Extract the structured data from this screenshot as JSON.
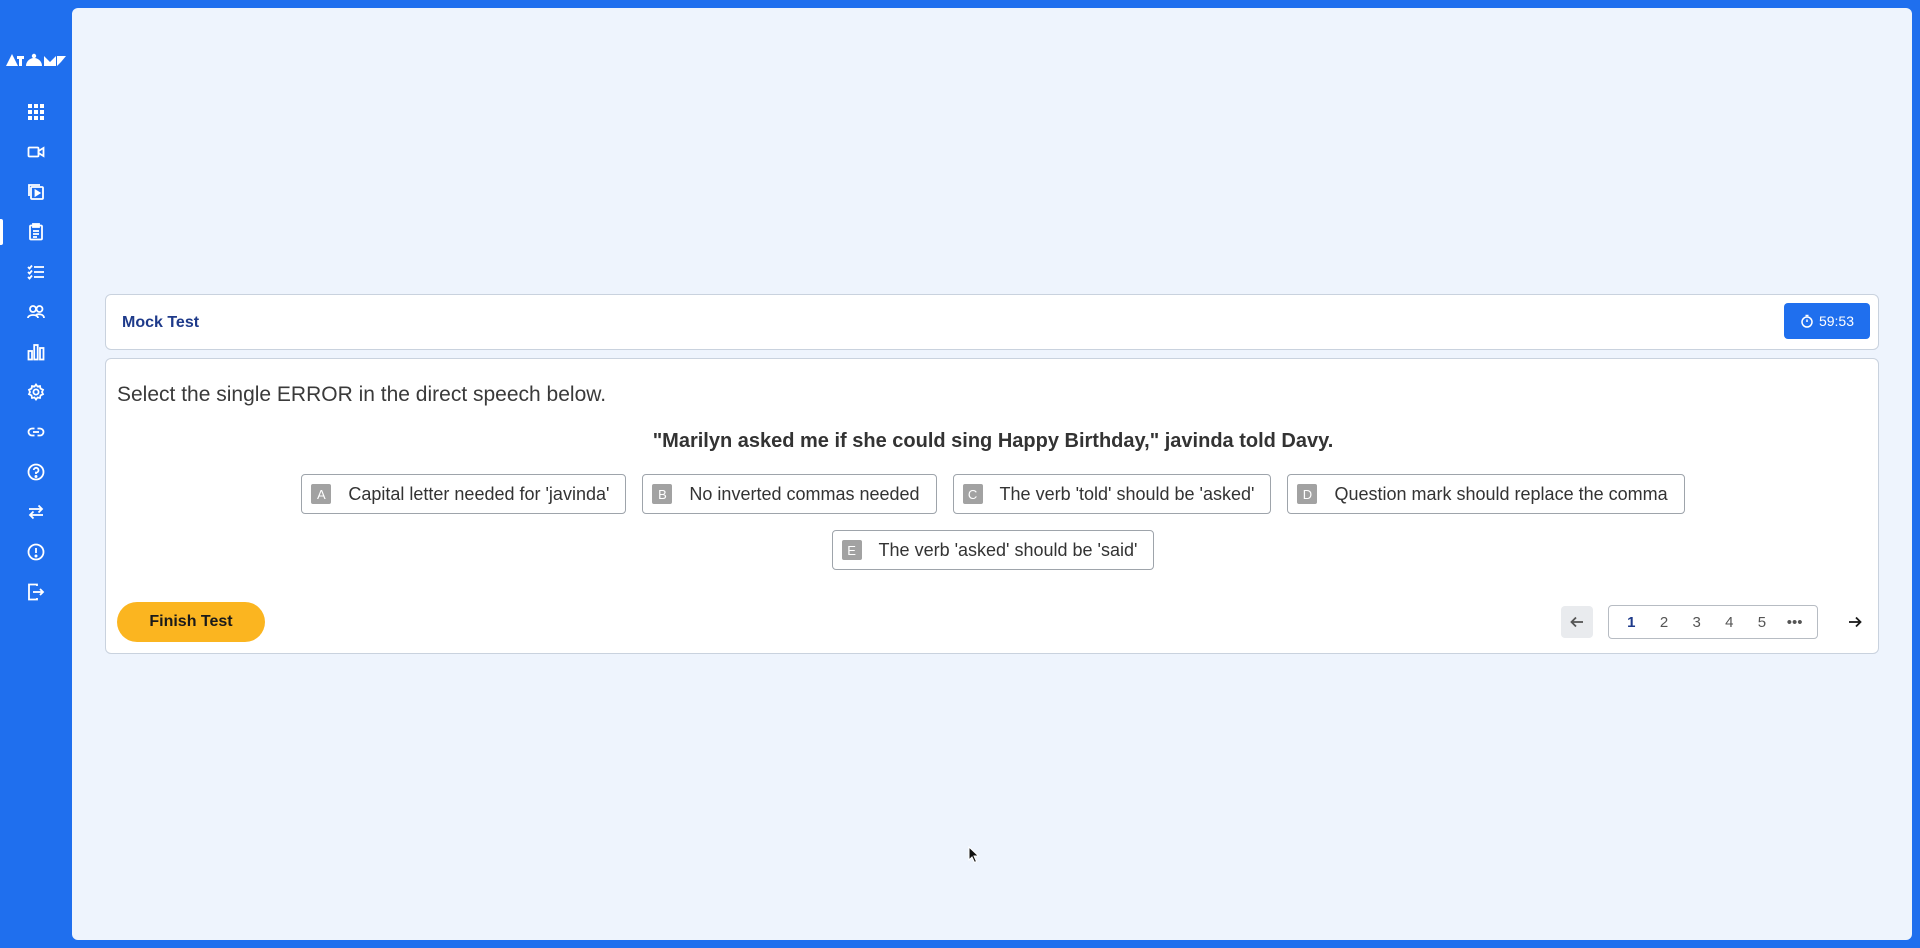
{
  "sidebar": {
    "logo_text": "AtoM",
    "items": [
      {
        "icon": "grid-icon",
        "active": false
      },
      {
        "icon": "video-icon",
        "active": false
      },
      {
        "icon": "playlist-icon",
        "active": false
      },
      {
        "icon": "clipboard-icon",
        "active": true
      },
      {
        "icon": "checklist-icon",
        "active": false
      },
      {
        "icon": "users-icon",
        "active": false
      },
      {
        "icon": "bar-chart-icon",
        "active": false
      },
      {
        "icon": "gear-icon",
        "active": false
      },
      {
        "icon": "link-icon",
        "active": false
      },
      {
        "icon": "help-icon",
        "active": false
      },
      {
        "icon": "swap-icon",
        "active": false
      },
      {
        "icon": "info-icon",
        "active": false
      },
      {
        "icon": "logout-icon",
        "active": false
      }
    ]
  },
  "header": {
    "title": "Mock Test",
    "timer": "59:53"
  },
  "question": {
    "instruction": "Select the single ERROR in the direct speech below.",
    "sentence": "\"Marilyn asked me if she could sing Happy Birthday,\" javinda told Davy.",
    "options": [
      {
        "letter": "A",
        "text": "Capital letter needed for 'javinda'"
      },
      {
        "letter": "B",
        "text": "No inverted commas needed"
      },
      {
        "letter": "C",
        "text": "The verb 'told' should be 'asked'"
      },
      {
        "letter": "D",
        "text": "Question mark should replace the comma"
      },
      {
        "letter": "E",
        "text": "The verb 'asked' should be 'said'"
      }
    ]
  },
  "footer": {
    "finish_label": "Finish Test",
    "pages": [
      "1",
      "2",
      "3",
      "4",
      "5"
    ],
    "current_page": "1",
    "more": "•••"
  },
  "colors": {
    "brand_blue": "#1f6fee",
    "panel_bg": "#eef4fd",
    "title_blue": "#1e3a8a",
    "finish_yellow": "#fbb520"
  }
}
